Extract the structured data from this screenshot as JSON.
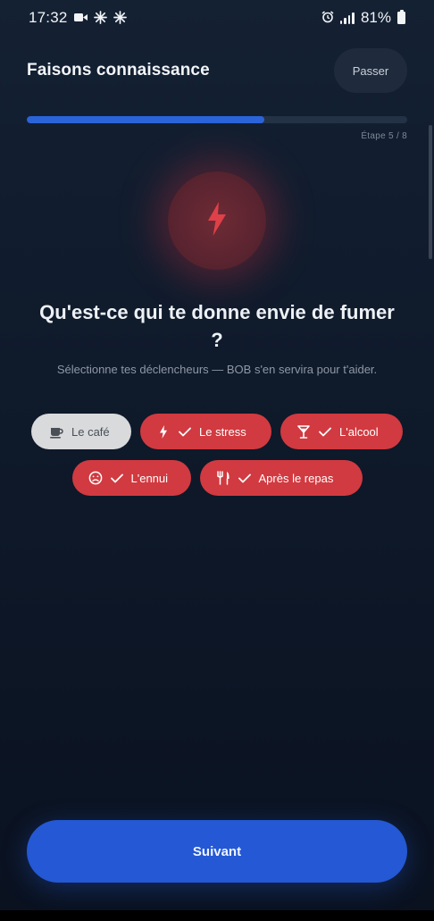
{
  "status_bar": {
    "time": "17:32",
    "battery": "81%",
    "left_icons": [
      "video-camera-icon",
      "pinwheel-icon",
      "pinwheel-icon"
    ],
    "right_icons": [
      "alarm-icon",
      "signal-icon",
      "battery-icon"
    ]
  },
  "header": {
    "title": "Faisons connaissance",
    "skip_label": "Passer"
  },
  "progress": {
    "current": 5,
    "total": 8,
    "fraction": 0.625,
    "label": "Étape 5 / 8"
  },
  "hero": {
    "icon": "lightning-icon",
    "color": "#e04048"
  },
  "question": {
    "title": "Qu'est-ce qui te donne envie de fumer ?",
    "subtitle": "Sélectionne tes déclencheurs — BOB s'en servira pour t'aider."
  },
  "triggers": [
    {
      "label": "Le café",
      "icon": "coffee-cup-icon",
      "selected": false
    },
    {
      "label": "Le stress",
      "icon": "lightning-icon",
      "selected": true
    },
    {
      "label": "L'alcool",
      "icon": "cocktail-glass-icon",
      "selected": true
    },
    {
      "label": "L'ennui",
      "icon": "sad-face-icon",
      "selected": true
    },
    {
      "label": "Après le repas",
      "icon": "fork-knife-icon",
      "selected": true
    }
  ],
  "footer": {
    "next_label": "Suivant"
  },
  "colors": {
    "accent": "#2458d4",
    "selected_chip": "#d13a40",
    "unselected_chip": "#d9dadc",
    "background": "#0f1a2b"
  }
}
